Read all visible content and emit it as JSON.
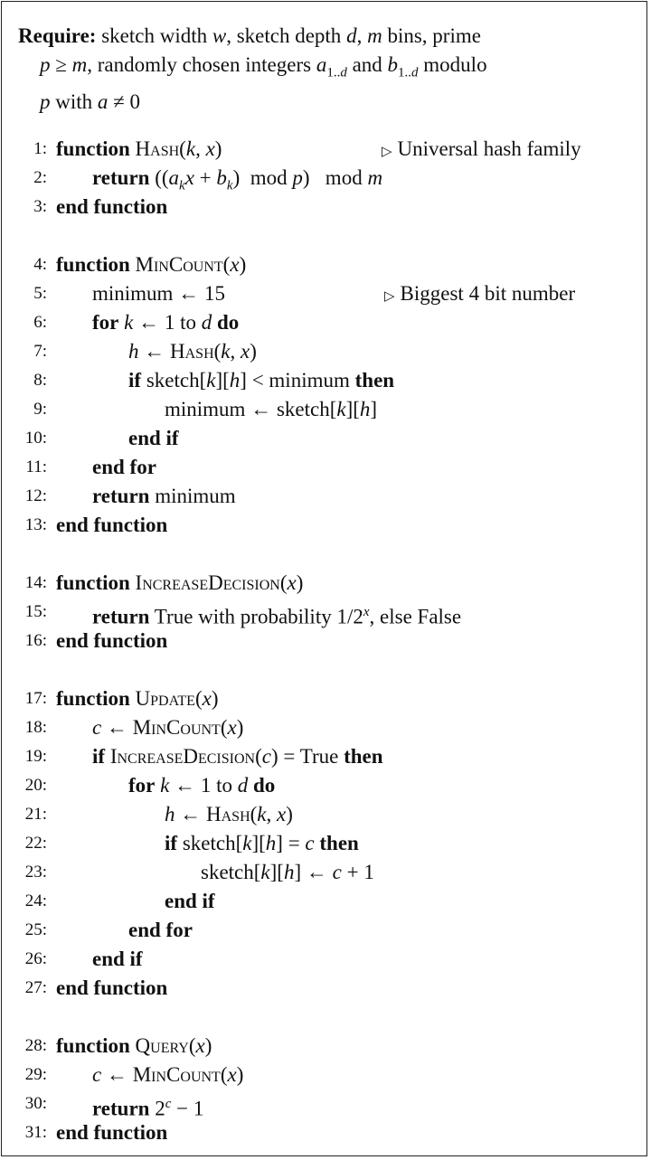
{
  "require": {
    "label": "Require:",
    "text": "sketch width w, sketch depth d, m bins, prime p ≥ m, randomly chosen integers a₁..d and b₁..d modulo p with a ≠ 0",
    "line1": "sketch width w, sketch depth d, m bins, prime",
    "line2": "p ≥ m, randomly chosen integers a1..d and b1..d modulo",
    "line3": "p with a ≠ 0"
  },
  "comment_icon": "triangle-right-icon",
  "lines": [
    {
      "n": "1:",
      "indent": 0,
      "text": "function Hash(k, x)",
      "comment": "Universal hash family"
    },
    {
      "n": "2:",
      "indent": 1,
      "text": "return ((a_k x + b_k) mod p) mod m"
    },
    {
      "n": "3:",
      "indent": 0,
      "text": "end function"
    },
    {
      "n": "4:",
      "indent": 0,
      "text": "function MinCount(x)"
    },
    {
      "n": "5:",
      "indent": 1,
      "text": "minimum ← 15",
      "comment": "Biggest 4 bit number"
    },
    {
      "n": "6:",
      "indent": 1,
      "text": "for k ← 1 to d do"
    },
    {
      "n": "7:",
      "indent": 2,
      "text": "h ← Hash(k, x)"
    },
    {
      "n": "8:",
      "indent": 2,
      "text": "if sketch[k][h] < minimum then"
    },
    {
      "n": "9:",
      "indent": 3,
      "text": "minimum ← sketch[k][h]"
    },
    {
      "n": "10:",
      "indent": 2,
      "text": "end if"
    },
    {
      "n": "11:",
      "indent": 1,
      "text": "end for"
    },
    {
      "n": "12:",
      "indent": 1,
      "text": "return minimum"
    },
    {
      "n": "13:",
      "indent": 0,
      "text": "end function"
    },
    {
      "n": "14:",
      "indent": 0,
      "text": "function IncreaseDecision(x)"
    },
    {
      "n": "15:",
      "indent": 1,
      "text": "return True with probability 1/2^x, else False"
    },
    {
      "n": "16:",
      "indent": 0,
      "text": "end function"
    },
    {
      "n": "17:",
      "indent": 0,
      "text": "function Update(x)"
    },
    {
      "n": "18:",
      "indent": 1,
      "text": "c ← MinCount(x)"
    },
    {
      "n": "19:",
      "indent": 1,
      "text": "if IncreaseDecision(c) = True then"
    },
    {
      "n": "20:",
      "indent": 2,
      "text": "for k ← 1 to d do"
    },
    {
      "n": "21:",
      "indent": 3,
      "text": "h ← Hash(k, x)"
    },
    {
      "n": "22:",
      "indent": 3,
      "text": "if sketch[k][h] = c then"
    },
    {
      "n": "23:",
      "indent": 4,
      "text": "sketch[k][h] ← c + 1"
    },
    {
      "n": "24:",
      "indent": 3,
      "text": "end if"
    },
    {
      "n": "25:",
      "indent": 2,
      "text": "end for"
    },
    {
      "n": "26:",
      "indent": 1,
      "text": "end if"
    },
    {
      "n": "27:",
      "indent": 0,
      "text": "end function"
    },
    {
      "n": "28:",
      "indent": 0,
      "text": "function Query(x)"
    },
    {
      "n": "29:",
      "indent": 1,
      "text": "c ← MinCount(x)"
    },
    {
      "n": "30:",
      "indent": 1,
      "text": "return 2^c − 1"
    },
    {
      "n": "31:",
      "indent": 0,
      "text": "end function"
    }
  ],
  "tokens": {
    "function": "function",
    "end_function": "end function",
    "return": "return",
    "for": "for",
    "do": "do",
    "if": "if",
    "then": "then",
    "end_if": "end if",
    "end_for": "end for",
    "to": "to",
    "hash": "Hash",
    "mincount": "MinCount",
    "increasedecision": "IncreaseDecision",
    "update": "Update",
    "query": "Query",
    "minimum": "minimum",
    "sketch": "sketch",
    "true": "True",
    "false": "False",
    "mod": "mod",
    "fifteen": "15",
    "one": "1",
    "two": "2",
    "with_prob": "True with probability 1/2",
    "else_false": ", else False"
  }
}
